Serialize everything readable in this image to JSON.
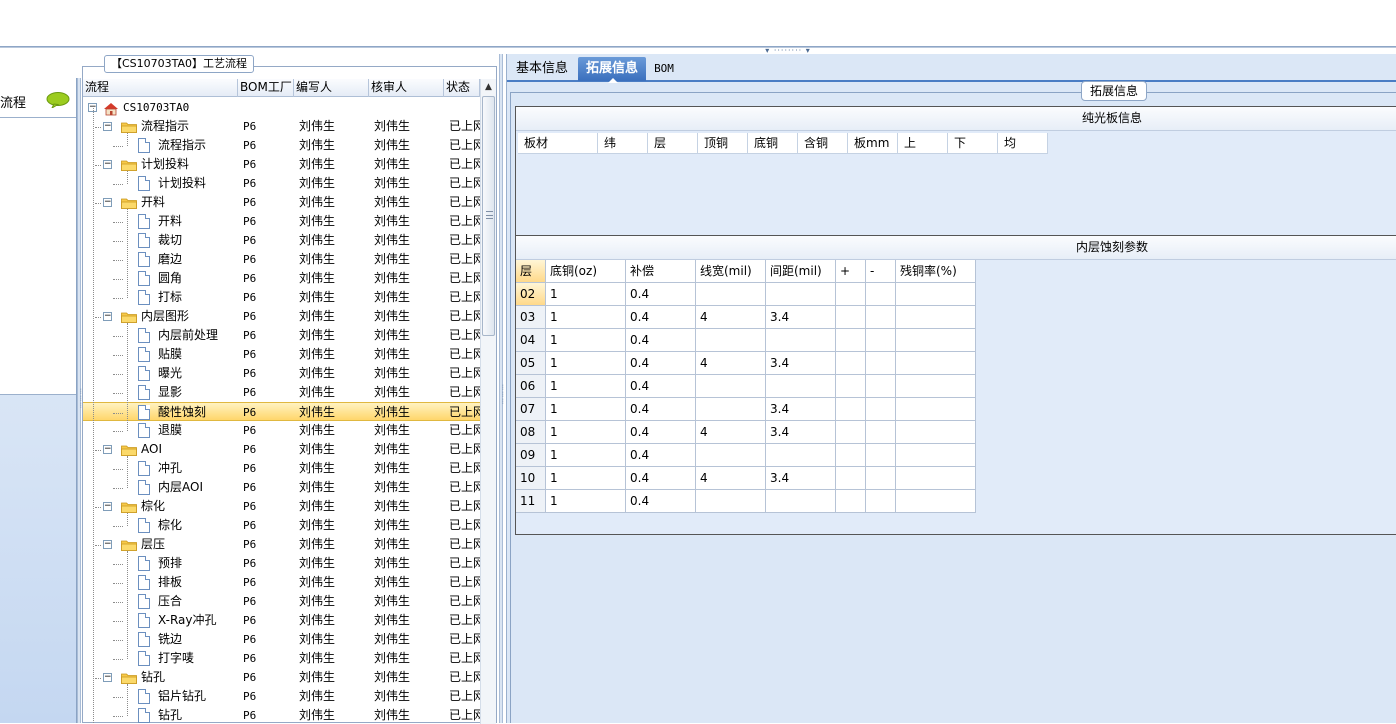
{
  "window": {
    "splitter_handle": "▾ ········ ▾"
  },
  "nav": {
    "item_label": "流程"
  },
  "tree": {
    "title": "【CS10703TA0】工艺流程",
    "columns": [
      "流程",
      "BOM工厂",
      "编写人",
      "核审人",
      "状态"
    ],
    "rows": [
      {
        "label": "CS10703TA0",
        "type": "root",
        "level": 0,
        "factory": "",
        "writer": "",
        "reviewer": "",
        "status": ""
      },
      {
        "label": "流程指示",
        "type": "folder",
        "level": 1,
        "factory": "P6",
        "writer": "刘伟生",
        "reviewer": "刘伟生",
        "status": "已上网"
      },
      {
        "label": "流程指示",
        "type": "doc",
        "level": 2,
        "factory": "P6",
        "writer": "刘伟生",
        "reviewer": "刘伟生",
        "status": "已上网"
      },
      {
        "label": "计划投料",
        "type": "folder",
        "level": 1,
        "factory": "P6",
        "writer": "刘伟生",
        "reviewer": "刘伟生",
        "status": "已上网"
      },
      {
        "label": "计划投料",
        "type": "doc",
        "level": 2,
        "factory": "P6",
        "writer": "刘伟生",
        "reviewer": "刘伟生",
        "status": "已上网"
      },
      {
        "label": "开料",
        "type": "folder",
        "level": 1,
        "factory": "P6",
        "writer": "刘伟生",
        "reviewer": "刘伟生",
        "status": "已上网"
      },
      {
        "label": "开料",
        "type": "doc",
        "level": 2,
        "factory": "P6",
        "writer": "刘伟生",
        "reviewer": "刘伟生",
        "status": "已上网"
      },
      {
        "label": "裁切",
        "type": "doc",
        "level": 2,
        "factory": "P6",
        "writer": "刘伟生",
        "reviewer": "刘伟生",
        "status": "已上网"
      },
      {
        "label": "磨边",
        "type": "doc",
        "level": 2,
        "factory": "P6",
        "writer": "刘伟生",
        "reviewer": "刘伟生",
        "status": "已上网"
      },
      {
        "label": "圆角",
        "type": "doc",
        "level": 2,
        "factory": "P6",
        "writer": "刘伟生",
        "reviewer": "刘伟生",
        "status": "已上网"
      },
      {
        "label": "打标",
        "type": "doc",
        "level": 2,
        "factory": "P6",
        "writer": "刘伟生",
        "reviewer": "刘伟生",
        "status": "已上网"
      },
      {
        "label": "内层图形",
        "type": "folder",
        "level": 1,
        "factory": "P6",
        "writer": "刘伟生",
        "reviewer": "刘伟生",
        "status": "已上网"
      },
      {
        "label": "内层前处理",
        "type": "doc",
        "level": 2,
        "factory": "P6",
        "writer": "刘伟生",
        "reviewer": "刘伟生",
        "status": "已上网"
      },
      {
        "label": "贴膜",
        "type": "doc",
        "level": 2,
        "factory": "P6",
        "writer": "刘伟生",
        "reviewer": "刘伟生",
        "status": "已上网"
      },
      {
        "label": "曝光",
        "type": "doc",
        "level": 2,
        "factory": "P6",
        "writer": "刘伟生",
        "reviewer": "刘伟生",
        "status": "已上网"
      },
      {
        "label": "显影",
        "type": "doc",
        "level": 2,
        "factory": "P6",
        "writer": "刘伟生",
        "reviewer": "刘伟生",
        "status": "已上网"
      },
      {
        "label": "酸性蚀刻",
        "type": "doc",
        "level": 2,
        "factory": "P6",
        "writer": "刘伟生",
        "reviewer": "刘伟生",
        "status": "已上网",
        "selected": true
      },
      {
        "label": "退膜",
        "type": "doc",
        "level": 2,
        "factory": "P6",
        "writer": "刘伟生",
        "reviewer": "刘伟生",
        "status": "已上网"
      },
      {
        "label": "AOI",
        "type": "folder",
        "level": 1,
        "factory": "P6",
        "writer": "刘伟生",
        "reviewer": "刘伟生",
        "status": "已上网"
      },
      {
        "label": "冲孔",
        "type": "doc",
        "level": 2,
        "factory": "P6",
        "writer": "刘伟生",
        "reviewer": "刘伟生",
        "status": "已上网"
      },
      {
        "label": "内层AOI",
        "type": "doc",
        "level": 2,
        "factory": "P6",
        "writer": "刘伟生",
        "reviewer": "刘伟生",
        "status": "已上网"
      },
      {
        "label": "棕化",
        "type": "folder",
        "level": 1,
        "factory": "P6",
        "writer": "刘伟生",
        "reviewer": "刘伟生",
        "status": "已上网"
      },
      {
        "label": "棕化",
        "type": "doc",
        "level": 2,
        "factory": "P6",
        "writer": "刘伟生",
        "reviewer": "刘伟生",
        "status": "已上网"
      },
      {
        "label": "层压",
        "type": "folder",
        "level": 1,
        "factory": "P6",
        "writer": "刘伟生",
        "reviewer": "刘伟生",
        "status": "已上网"
      },
      {
        "label": "预排",
        "type": "doc",
        "level": 2,
        "factory": "P6",
        "writer": "刘伟生",
        "reviewer": "刘伟生",
        "status": "已上网"
      },
      {
        "label": "排板",
        "type": "doc",
        "level": 2,
        "factory": "P6",
        "writer": "刘伟生",
        "reviewer": "刘伟生",
        "status": "已上网"
      },
      {
        "label": "压合",
        "type": "doc",
        "level": 2,
        "factory": "P6",
        "writer": "刘伟生",
        "reviewer": "刘伟生",
        "status": "已上网"
      },
      {
        "label": "X-Ray冲孔",
        "type": "doc",
        "level": 2,
        "factory": "P6",
        "writer": "刘伟生",
        "reviewer": "刘伟生",
        "status": "已上网"
      },
      {
        "label": "铣边",
        "type": "doc",
        "level": 2,
        "factory": "P6",
        "writer": "刘伟生",
        "reviewer": "刘伟生",
        "status": "已上网"
      },
      {
        "label": "打字唛",
        "type": "doc",
        "level": 2,
        "factory": "P6",
        "writer": "刘伟生",
        "reviewer": "刘伟生",
        "status": "已上网"
      },
      {
        "label": "钻孔",
        "type": "folder",
        "level": 1,
        "factory": "P6",
        "writer": "刘伟生",
        "reviewer": "刘伟生",
        "status": "已上网"
      },
      {
        "label": "铝片钻孔",
        "type": "doc",
        "level": 2,
        "factory": "P6",
        "writer": "刘伟生",
        "reviewer": "刘伟生",
        "status": "已上网"
      },
      {
        "label": "钻孔",
        "type": "doc",
        "level": 2,
        "factory": "P6",
        "writer": "刘伟生",
        "reviewer": "刘伟生",
        "status": "已上网"
      }
    ]
  },
  "tabs": [
    {
      "label": "基本信息",
      "active": false
    },
    {
      "label": "拓展信息",
      "active": true
    },
    {
      "label": "BOM",
      "active": false
    }
  ],
  "extended": {
    "legend": "拓展信息",
    "plain_board": {
      "title": "纯光板信息",
      "columns": [
        "板材",
        "纬",
        "层",
        "顶铜",
        "底铜",
        "含铜",
        "板mm",
        "上",
        "下",
        "均"
      ]
    },
    "etch": {
      "title": "内层蚀刻参数",
      "columns": [
        "层",
        "底铜(oz)",
        "补偿",
        "线宽(mil)",
        "间距(mil)",
        "+",
        "-",
        "残铜率(%)"
      ],
      "rows": [
        [
          "02",
          "1",
          "0.4",
          "",
          "",
          "",
          "",
          ""
        ],
        [
          "03",
          "1",
          "0.4",
          "4",
          "3.4",
          "",
          "",
          ""
        ],
        [
          "04",
          "1",
          "0.4",
          "",
          "",
          "",
          "",
          ""
        ],
        [
          "05",
          "1",
          "0.4",
          "4",
          "3.4",
          "",
          "",
          ""
        ],
        [
          "06",
          "1",
          "0.4",
          "",
          "",
          "",
          "",
          ""
        ],
        [
          "07",
          "1",
          "0.4",
          "",
          "3.4",
          "",
          "",
          ""
        ],
        [
          "08",
          "1",
          "0.4",
          "4",
          "3.4",
          "",
          "",
          ""
        ],
        [
          "09",
          "1",
          "0.4",
          "",
          "",
          "",
          "",
          ""
        ],
        [
          "10",
          "1",
          "0.4",
          "4",
          "3.4",
          "",
          "",
          ""
        ],
        [
          "11",
          "1",
          "0.4",
          "",
          "",
          "",
          "",
          ""
        ]
      ],
      "current_row": "02"
    }
  },
  "colors": {
    "selection": "#ffd66b",
    "tab_active": "#3a6fbd",
    "panel_bg": "#dbe7f6"
  }
}
